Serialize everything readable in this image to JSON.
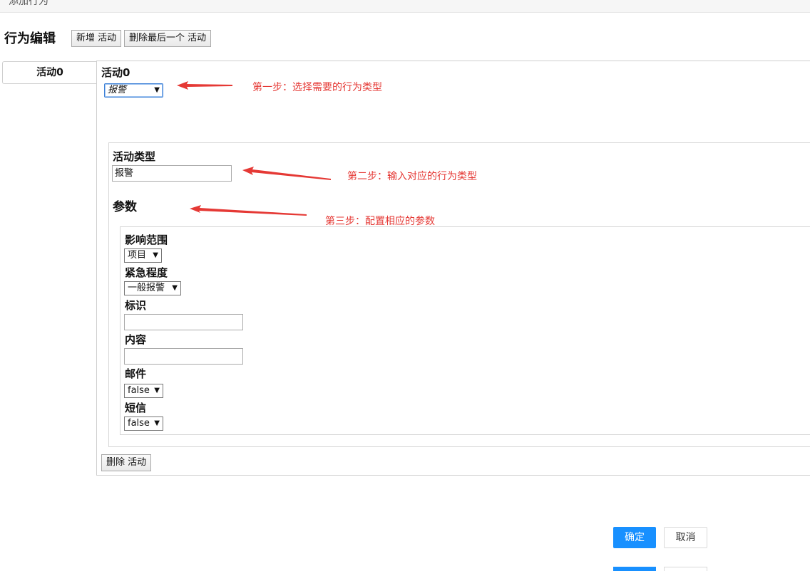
{
  "window": {
    "title": "添加行为"
  },
  "page": {
    "title": "行为编辑"
  },
  "toolbar": {
    "add_label": "新增 活动",
    "remove_last_label": "删除最后一个 活动"
  },
  "tabs": [
    {
      "label": "活动0"
    }
  ],
  "activity": {
    "heading": "活动0",
    "type_select_value": "报警",
    "type_label": "活动类型",
    "type_input_value": "报警",
    "params_heading": "参数",
    "delete_label": "删除 活动"
  },
  "params": {
    "scope": {
      "label": "影响范围",
      "value": "项目"
    },
    "urgency": {
      "label": "紧急程度",
      "value": "一般报警"
    },
    "identifier": {
      "label": "标识",
      "value": ""
    },
    "content": {
      "label": "内容",
      "value": ""
    },
    "email": {
      "label": "邮件",
      "value": "false"
    },
    "sms": {
      "label": "短信",
      "value": "false"
    }
  },
  "annotations": {
    "step1": "第一步：选择需要的行为类型",
    "step2": "第二步：输入对应的行为类型",
    "step3": "第三步：配置相应的参数",
    "color": "#e53935"
  },
  "footer": {
    "ok_label": "确定",
    "cancel_label": "取消",
    "accent": "#1890ff"
  }
}
